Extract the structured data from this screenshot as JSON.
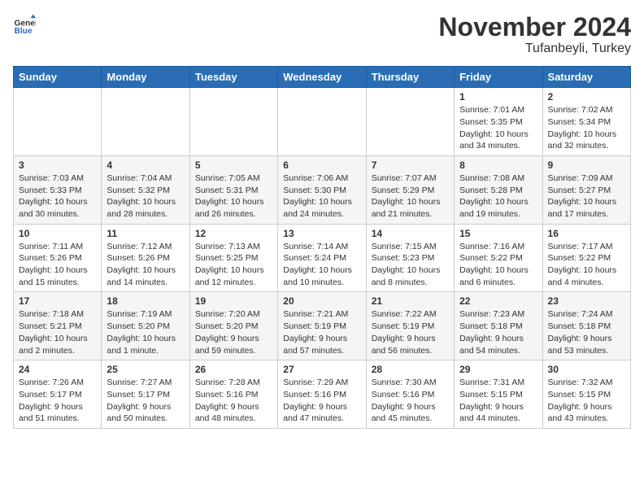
{
  "header": {
    "logo_general": "General",
    "logo_blue": "Blue",
    "title": "November 2024",
    "subtitle": "Tufanbeyli, Turkey"
  },
  "days_of_week": [
    "Sunday",
    "Monday",
    "Tuesday",
    "Wednesday",
    "Thursday",
    "Friday",
    "Saturday"
  ],
  "weeks": [
    [
      {
        "day": "",
        "info": ""
      },
      {
        "day": "",
        "info": ""
      },
      {
        "day": "",
        "info": ""
      },
      {
        "day": "",
        "info": ""
      },
      {
        "day": "",
        "info": ""
      },
      {
        "day": "1",
        "info": "Sunrise: 7:01 AM\nSunset: 5:35 PM\nDaylight: 10 hours\nand 34 minutes."
      },
      {
        "day": "2",
        "info": "Sunrise: 7:02 AM\nSunset: 5:34 PM\nDaylight: 10 hours\nand 32 minutes."
      }
    ],
    [
      {
        "day": "3",
        "info": "Sunrise: 7:03 AM\nSunset: 5:33 PM\nDaylight: 10 hours\nand 30 minutes."
      },
      {
        "day": "4",
        "info": "Sunrise: 7:04 AM\nSunset: 5:32 PM\nDaylight: 10 hours\nand 28 minutes."
      },
      {
        "day": "5",
        "info": "Sunrise: 7:05 AM\nSunset: 5:31 PM\nDaylight: 10 hours\nand 26 minutes."
      },
      {
        "day": "6",
        "info": "Sunrise: 7:06 AM\nSunset: 5:30 PM\nDaylight: 10 hours\nand 24 minutes."
      },
      {
        "day": "7",
        "info": "Sunrise: 7:07 AM\nSunset: 5:29 PM\nDaylight: 10 hours\nand 21 minutes."
      },
      {
        "day": "8",
        "info": "Sunrise: 7:08 AM\nSunset: 5:28 PM\nDaylight: 10 hours\nand 19 minutes."
      },
      {
        "day": "9",
        "info": "Sunrise: 7:09 AM\nSunset: 5:27 PM\nDaylight: 10 hours\nand 17 minutes."
      }
    ],
    [
      {
        "day": "10",
        "info": "Sunrise: 7:11 AM\nSunset: 5:26 PM\nDaylight: 10 hours\nand 15 minutes."
      },
      {
        "day": "11",
        "info": "Sunrise: 7:12 AM\nSunset: 5:26 PM\nDaylight: 10 hours\nand 14 minutes."
      },
      {
        "day": "12",
        "info": "Sunrise: 7:13 AM\nSunset: 5:25 PM\nDaylight: 10 hours\nand 12 minutes."
      },
      {
        "day": "13",
        "info": "Sunrise: 7:14 AM\nSunset: 5:24 PM\nDaylight: 10 hours\nand 10 minutes."
      },
      {
        "day": "14",
        "info": "Sunrise: 7:15 AM\nSunset: 5:23 PM\nDaylight: 10 hours\nand 8 minutes."
      },
      {
        "day": "15",
        "info": "Sunrise: 7:16 AM\nSunset: 5:22 PM\nDaylight: 10 hours\nand 6 minutes."
      },
      {
        "day": "16",
        "info": "Sunrise: 7:17 AM\nSunset: 5:22 PM\nDaylight: 10 hours\nand 4 minutes."
      }
    ],
    [
      {
        "day": "17",
        "info": "Sunrise: 7:18 AM\nSunset: 5:21 PM\nDaylight: 10 hours\nand 2 minutes."
      },
      {
        "day": "18",
        "info": "Sunrise: 7:19 AM\nSunset: 5:20 PM\nDaylight: 10 hours\nand 1 minute."
      },
      {
        "day": "19",
        "info": "Sunrise: 7:20 AM\nSunset: 5:20 PM\nDaylight: 9 hours\nand 59 minutes."
      },
      {
        "day": "20",
        "info": "Sunrise: 7:21 AM\nSunset: 5:19 PM\nDaylight: 9 hours\nand 57 minutes."
      },
      {
        "day": "21",
        "info": "Sunrise: 7:22 AM\nSunset: 5:19 PM\nDaylight: 9 hours\nand 56 minutes."
      },
      {
        "day": "22",
        "info": "Sunrise: 7:23 AM\nSunset: 5:18 PM\nDaylight: 9 hours\nand 54 minutes."
      },
      {
        "day": "23",
        "info": "Sunrise: 7:24 AM\nSunset: 5:18 PM\nDaylight: 9 hours\nand 53 minutes."
      }
    ],
    [
      {
        "day": "24",
        "info": "Sunrise: 7:26 AM\nSunset: 5:17 PM\nDaylight: 9 hours\nand 51 minutes."
      },
      {
        "day": "25",
        "info": "Sunrise: 7:27 AM\nSunset: 5:17 PM\nDaylight: 9 hours\nand 50 minutes."
      },
      {
        "day": "26",
        "info": "Sunrise: 7:28 AM\nSunset: 5:16 PM\nDaylight: 9 hours\nand 48 minutes."
      },
      {
        "day": "27",
        "info": "Sunrise: 7:29 AM\nSunset: 5:16 PM\nDaylight: 9 hours\nand 47 minutes."
      },
      {
        "day": "28",
        "info": "Sunrise: 7:30 AM\nSunset: 5:16 PM\nDaylight: 9 hours\nand 45 minutes."
      },
      {
        "day": "29",
        "info": "Sunrise: 7:31 AM\nSunset: 5:15 PM\nDaylight: 9 hours\nand 44 minutes."
      },
      {
        "day": "30",
        "info": "Sunrise: 7:32 AM\nSunset: 5:15 PM\nDaylight: 9 hours\nand 43 minutes."
      }
    ]
  ]
}
